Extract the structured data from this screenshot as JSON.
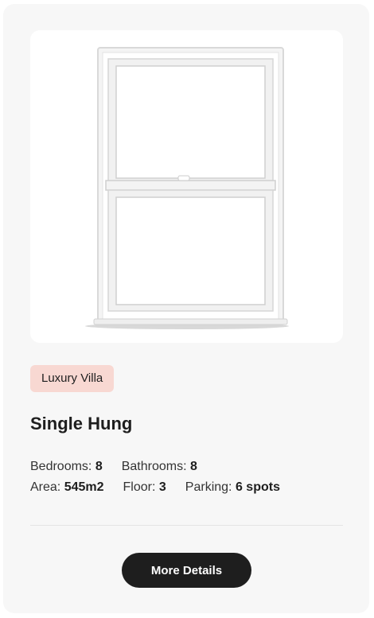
{
  "card": {
    "image_alt": "Single hung window",
    "badge": "Luxury Villa",
    "title": "Single Hung",
    "specs": {
      "bedrooms_label": "Bedrooms:",
      "bedrooms_value": "8",
      "bathrooms_label": "Bathrooms:",
      "bathrooms_value": "8",
      "area_label": "Area:",
      "area_value": "545m2",
      "floor_label": "Floor:",
      "floor_value": "3",
      "parking_label": "Parking:",
      "parking_value": "6 spots"
    },
    "button_label": "More Details"
  },
  "colors": {
    "card_background": "#f7f7f7",
    "badge_background": "#f8d8d2",
    "button_background": "#1e1e1e",
    "button_text": "#ffffff"
  }
}
